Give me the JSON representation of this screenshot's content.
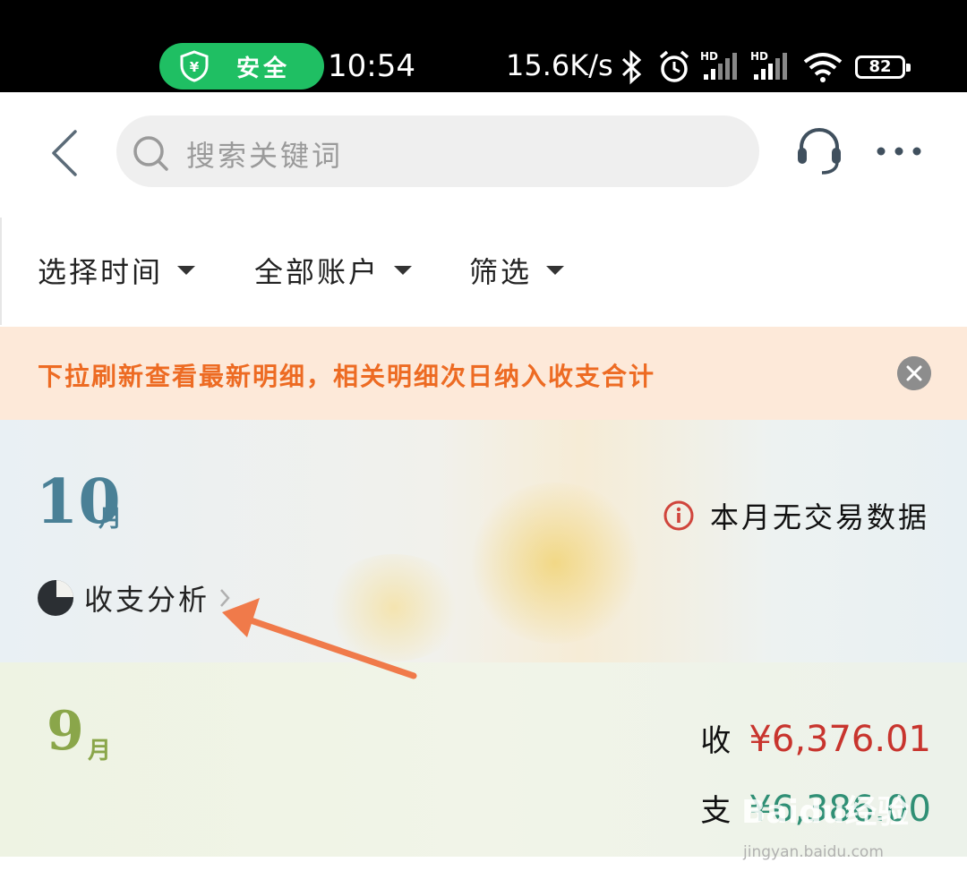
{
  "status_bar": {
    "safe_label": "安全",
    "time": "10:54",
    "network_speed": "15.6K/s",
    "battery": "82",
    "icons": [
      "shield-yuan-icon",
      "bluetooth-icon",
      "alarm-icon",
      "signal-hd-icon",
      "signal-hd-icon",
      "wifi-icon",
      "battery-icon"
    ]
  },
  "header": {
    "search_placeholder": "搜索关键词",
    "icons": [
      "back-icon",
      "search-icon",
      "headset-icon",
      "more-icon"
    ]
  },
  "filters": [
    {
      "label": "选择时间"
    },
    {
      "label": "全部账户"
    },
    {
      "label": "筛选"
    }
  ],
  "notice": {
    "text": "下拉刷新查看最新明细，相关明细次日纳入收支合计"
  },
  "months": [
    {
      "month": "10",
      "unit": "月",
      "status": "本月无交易数据",
      "analysis_label": "收支分析"
    },
    {
      "month": "9",
      "unit": "月",
      "income_label": "收",
      "income_amount": "¥6,376.01",
      "expense_label": "支",
      "expense_amount": "¥6,386.00"
    }
  ],
  "watermark": {
    "text": "Baidu经验",
    "sub": "jingyan.baidu.com"
  },
  "colors": {
    "safe_green": "#1fbf63",
    "notice_text": "#ed6b23",
    "income": "#c8352e",
    "expense": "#2f8f75",
    "annotation_arrow": "#f07a4a"
  }
}
